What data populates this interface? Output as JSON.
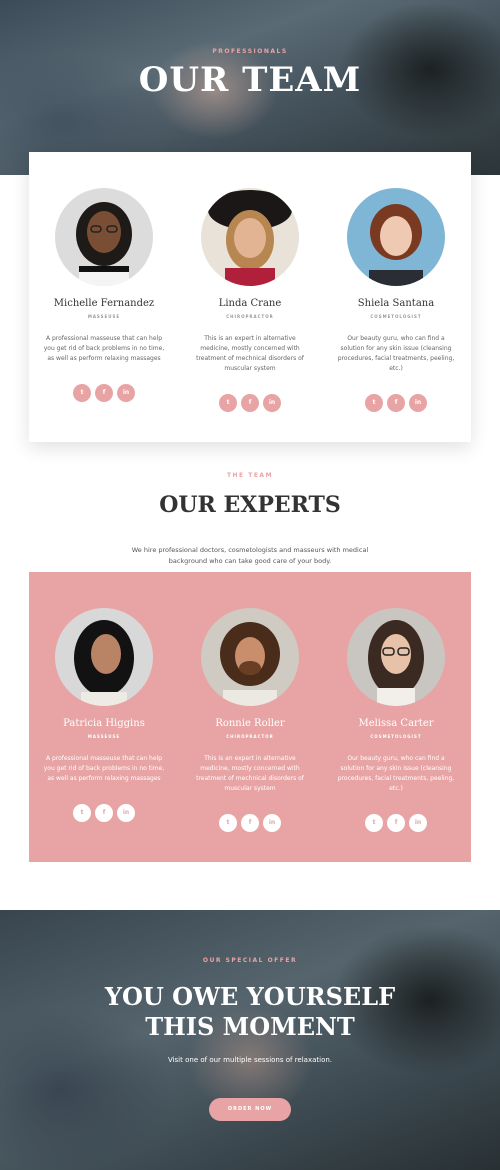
{
  "hero": {
    "eyebrow": "PROFESSIONALS",
    "title": "OUR TEAM"
  },
  "team": [
    {
      "name": "Michelle Fernandez",
      "role": "MASSEUSE",
      "desc": "A professional masseuse that can help you get rid of back problems in no time, as well as perform relaxing massages"
    },
    {
      "name": "Linda Crane",
      "role": "CHIROPRACTOR",
      "desc": "This is an expert in alternative medicine, mostly concerned with treatment of mechnical disorders of muscular system"
    },
    {
      "name": "Shiela Santana",
      "role": "COSMETOLOGIST",
      "desc": "Our beauty guru, who can find a solution for any skin issue (cleansing procedures, facial treatments, peeling, etc.)"
    }
  ],
  "experts_section": {
    "eyebrow": "THE TEAM",
    "title": "OUR EXPERTS",
    "subtitle": "We hire professional doctors, cosmetologists and masseurs with medical background who can take good care of your body."
  },
  "experts": [
    {
      "name": "Patricia Higgins",
      "role": "MASSEUSE",
      "desc": "A professional masseuse that can help you get rid of back problems in no time, as well as perform relaxing massages"
    },
    {
      "name": "Ronnie Roller",
      "role": "CHIROPRACTOR",
      "desc": "This is an expert in alternative medicine, mostly concerned with treatment of mechnical disorders of muscular system"
    },
    {
      "name": "Melissa Carter",
      "role": "COSMETOLOGIST",
      "desc": "Our beauty guru, who can find a solution for any skin issue (cleansing procedures, facial treatments, peeling, etc.)"
    }
  ],
  "social_icons": {
    "twitter": "t",
    "facebook": "f",
    "linkedin": "in"
  },
  "offer": {
    "eyebrow": "OUR SPECIAL OFFER",
    "title_line1": "YOU OWE YOURSELF",
    "title_line2": "THIS MOMENT",
    "text": "Visit one of our multiple sessions of relaxation.",
    "button": "ORDER NOW"
  },
  "colors": {
    "accent": "#e8a4a4",
    "text": "#333333",
    "white": "#ffffff"
  }
}
